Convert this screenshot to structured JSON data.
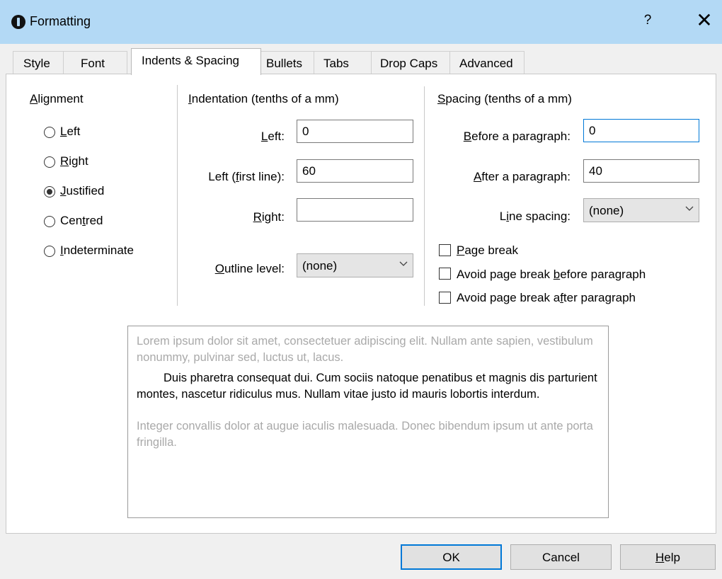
{
  "window": {
    "title": "Formatting",
    "help_glyph": "?",
    "close_glyph": "✕"
  },
  "tabs": [
    {
      "label": "Style"
    },
    {
      "label": "Font"
    },
    {
      "label": "Indents & Spacing",
      "active": true
    },
    {
      "label": "Bullets"
    },
    {
      "label": "Tabs"
    },
    {
      "label": "Drop Caps"
    },
    {
      "label": "Advanced"
    }
  ],
  "alignment": {
    "heading": "Alignment",
    "options": [
      {
        "label": "Left",
        "checked": false
      },
      {
        "label": "Right",
        "checked": false
      },
      {
        "label": "Justified",
        "checked": true
      },
      {
        "label": "Centred",
        "checked": false
      },
      {
        "label": "Indeterminate",
        "checked": false
      }
    ]
  },
  "indentation": {
    "heading": "Indentation (tenths of a mm)",
    "left_label": "Left:",
    "left_value": "0",
    "first_line_label": "Left (first line):",
    "first_line_value": "60",
    "right_label": "Right:",
    "right_value": "",
    "outline_label": "Outline level:",
    "outline_value": "(none)"
  },
  "spacing": {
    "heading": "Spacing (tenths of a mm)",
    "before_label": "Before a paragraph:",
    "before_value": "0",
    "after_label": "After a paragraph:",
    "after_value": "40",
    "line_label": "Line spacing:",
    "line_value": "(none)",
    "page_break_label": "Page break",
    "avoid_before_label": "Avoid page break before paragraph",
    "avoid_after_label": "Avoid page break after paragraph"
  },
  "preview": {
    "before_text": "Lorem ipsum dolor sit amet, consectetuer adipiscing elit. Nullam ante sapien, vestibulum nonummy, pulvinar sed, luctus ut, lacus.",
    "main_text": "Duis pharetra consequat dui. Cum sociis natoque penatibus et magnis dis parturient montes, nascetur ridiculus mus. Nullam vitae justo id mauris lobortis interdum.",
    "after_text": "Integer convallis dolor at augue iaculis malesuada. Donec bibendum ipsum ut ante porta fringilla."
  },
  "buttons": {
    "ok": "OK",
    "cancel": "Cancel",
    "help": "Help"
  },
  "colors": {
    "titlebar": "#b3d9f5",
    "focus_border": "#0078d7",
    "preview_muted_text": "#a9a9a9"
  }
}
